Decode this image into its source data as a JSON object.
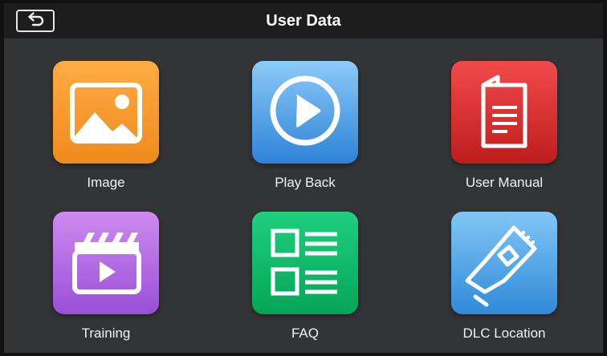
{
  "header": {
    "title": "User Data"
  },
  "tiles": [
    {
      "label": "Image",
      "icon": "image-icon",
      "color_top": "#ffac45",
      "color_bottom": "#f08a1c"
    },
    {
      "label": "Play Back",
      "icon": "play-icon",
      "color_top": "#8ccaf7",
      "color_bottom": "#2d83d8"
    },
    {
      "label": "User Manual",
      "icon": "manual-icon",
      "color_top": "#f24a4a",
      "color_bottom": "#be1d1d"
    },
    {
      "label": "Training",
      "icon": "clapperboard-icon",
      "color_top": "#cf8af0",
      "color_bottom": "#9a4fd8"
    },
    {
      "label": "FAQ",
      "icon": "faq-list-icon",
      "color_top": "#1ed07d",
      "color_bottom": "#06a457"
    },
    {
      "label": "DLC Location",
      "icon": "dlc-connector-icon",
      "color_top": "#82c6f6",
      "color_bottom": "#2f8ad9"
    }
  ]
}
